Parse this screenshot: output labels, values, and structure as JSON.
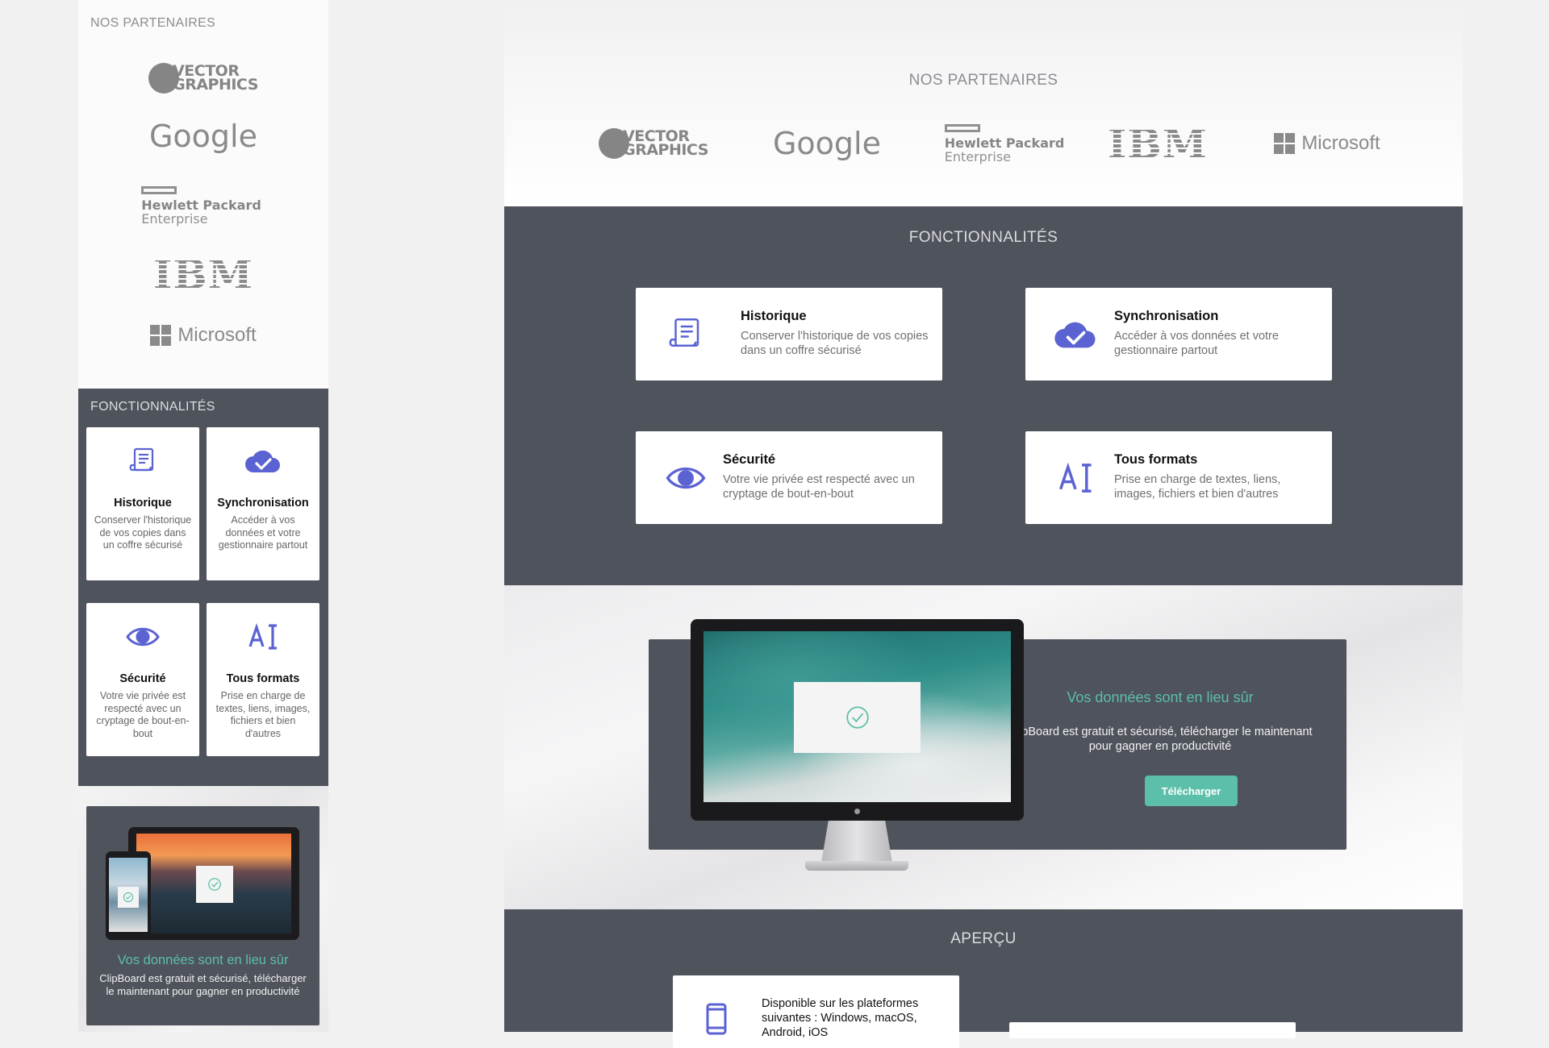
{
  "mobile": {
    "partners": {
      "title": "NOS PARTENAIRES",
      "logos": {
        "vector": [
          "VECTOR",
          "GRAPHICS"
        ],
        "google": "Google",
        "hpe": [
          "Hewlett Packard",
          "Enterprise"
        ],
        "ibm": "IBM",
        "microsoft": "Microsoft"
      }
    },
    "features": {
      "title": "FONCTIONNALITÉS",
      "items": [
        {
          "title": "Historique",
          "desc": "Conserver l'historique de vos copies dans un coffre sécurisé",
          "icon": "scroll-icon"
        },
        {
          "title": "Synchronisation",
          "desc": "Accéder à vos données et votre gestionnaire partout",
          "icon": "cloud-check-icon"
        },
        {
          "title": "Sécurité",
          "desc": "Votre vie privée est respecté avec un cryptage de bout-en-bout",
          "icon": "eye-icon"
        },
        {
          "title": "Tous formats",
          "desc": "Prise en charge de textes, liens, images, fichiers et bien d'autres",
          "icon": "text-format-icon"
        }
      ]
    },
    "promo": {
      "title": "Vos données sont en lieu sûr",
      "desc": "ClipBoard est gratuit et sécurisé, télécharger le maintenant pour gagner en productivité"
    }
  },
  "desktop": {
    "partners": {
      "title": "NOS PARTENAIRES",
      "logos": {
        "vector": [
          "VECTOR",
          "GRAPHICS"
        ],
        "google": "Google",
        "hpe": [
          "Hewlett Packard",
          "Enterprise"
        ],
        "ibm": "IBM",
        "microsoft": "Microsoft"
      }
    },
    "features": {
      "title": "FONCTIONNALITÉS",
      "items": [
        {
          "title": "Historique",
          "desc": "Conserver l'historique de vos copies dans un coffre sécurisé",
          "icon": "scroll-icon"
        },
        {
          "title": "Synchronisation",
          "desc": "Accéder à vos données et votre gestionnaire partout",
          "icon": "cloud-check-icon"
        },
        {
          "title": "Sécurité",
          "desc": "Votre vie privée est respecté avec un cryptage de bout-en-bout",
          "icon": "eye-icon"
        },
        {
          "title": "Tous formats",
          "desc": "Prise en charge de textes, liens, images, fichiers et bien d'autres",
          "icon": "text-format-icon"
        }
      ]
    },
    "promo": {
      "title": "Vos données sont en lieu sûr",
      "desc": "ClipBoard est gratuit et sécurisé, télécharger le maintenant pour gagner en productivité",
      "button": "Télécharger"
    },
    "apercu": {
      "title": "APERÇU",
      "platforms": "Disponible sur les plateformes suivantes : Windows, macOS, Android, iOS"
    }
  },
  "colors": {
    "dark_section": "#4f535c",
    "accent_teal": "#5bbfa9",
    "icon_purple": "#5b63d3"
  }
}
